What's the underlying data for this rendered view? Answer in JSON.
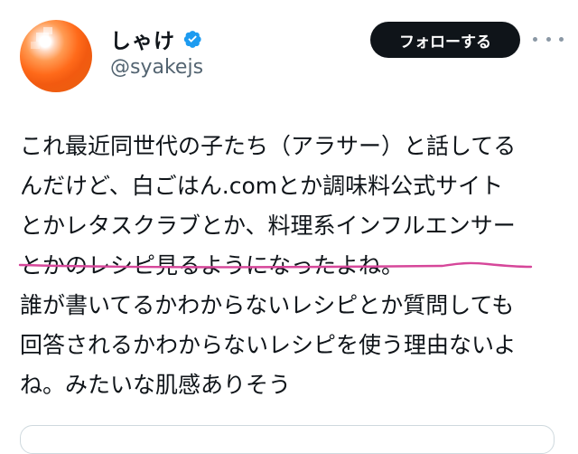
{
  "profile": {
    "display_name": "しゃけ",
    "handle": "@syakejs",
    "verified_icon": "verified-badge-icon",
    "avatar_colors": [
      "#ff6a1a",
      "#ff9a52",
      "#ffffff"
    ]
  },
  "actions": {
    "follow_label": "フォローする",
    "more_icon": "more-horizontal-icon"
  },
  "tweet": {
    "lines": [
      "これ最近同世代の子たち（アラサー）と話してる",
      "んだけど、白ごはん.comとか調味料公式サイト",
      "とかレタスクラブとか、料理系インフルエンサー",
      "とかのレシピ見るようになったよね。",
      "誰が書いてるかわからないレシピとか質問しても",
      "回答されるかわからないレシピを使う理由ないよ",
      "ね。みたいな肌感ありそう"
    ],
    "highlight_color": "#d6479a"
  },
  "colors": {
    "accent": "#1d9bf0",
    "text": "#0f1419",
    "secondary": "#536471",
    "button_bg": "#0f1419"
  }
}
